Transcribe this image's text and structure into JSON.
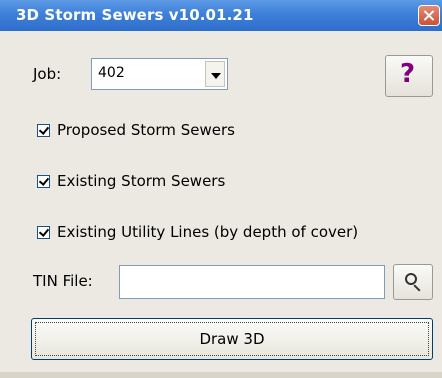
{
  "window": {
    "title": "3D Storm Sewers  v10.01.21"
  },
  "job": {
    "label": "Job:",
    "value": "402"
  },
  "help": {
    "label": "?"
  },
  "checkboxes": [
    {
      "label": "Proposed Storm Sewers",
      "checked": true
    },
    {
      "label": "Existing Storm Sewers",
      "checked": true
    },
    {
      "label": "Existing Utility Lines (by depth of cover)",
      "checked": true
    }
  ],
  "tin": {
    "label": "TIN File:",
    "value": ""
  },
  "actions": {
    "draw_label": "Draw 3D"
  },
  "icons": {
    "close": "close-icon",
    "dropdown": "chevron-down-icon",
    "browse": "search-icon"
  }
}
